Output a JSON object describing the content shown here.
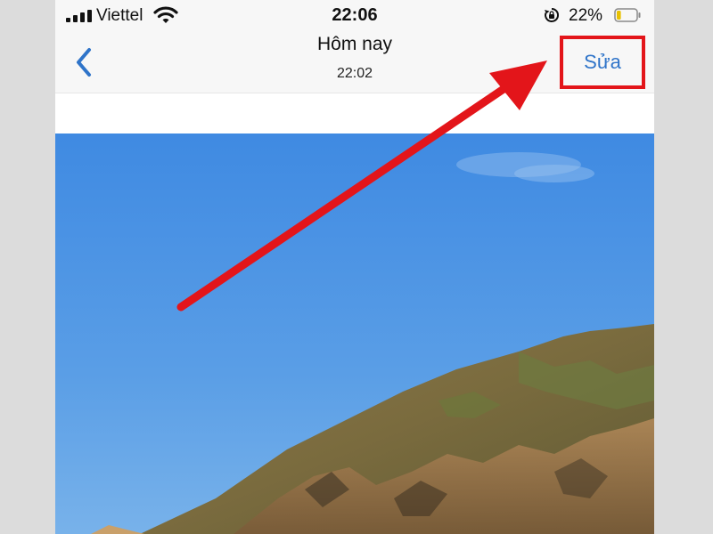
{
  "status_bar": {
    "carrier": "Viettel",
    "time": "22:06",
    "battery_percent": "22%",
    "battery_level": 0.22,
    "icons": [
      "signal-icon",
      "wifi-icon",
      "rotation-lock-icon",
      "battery-icon"
    ]
  },
  "nav": {
    "title": "Hôm nay",
    "subtitle": "22:02",
    "edit_label": "Sửa",
    "back_icon": "chevron-left-icon"
  },
  "colors": {
    "accent": "#2f74c9",
    "highlight": "#e3151a",
    "sky": "#4a8fe0"
  }
}
